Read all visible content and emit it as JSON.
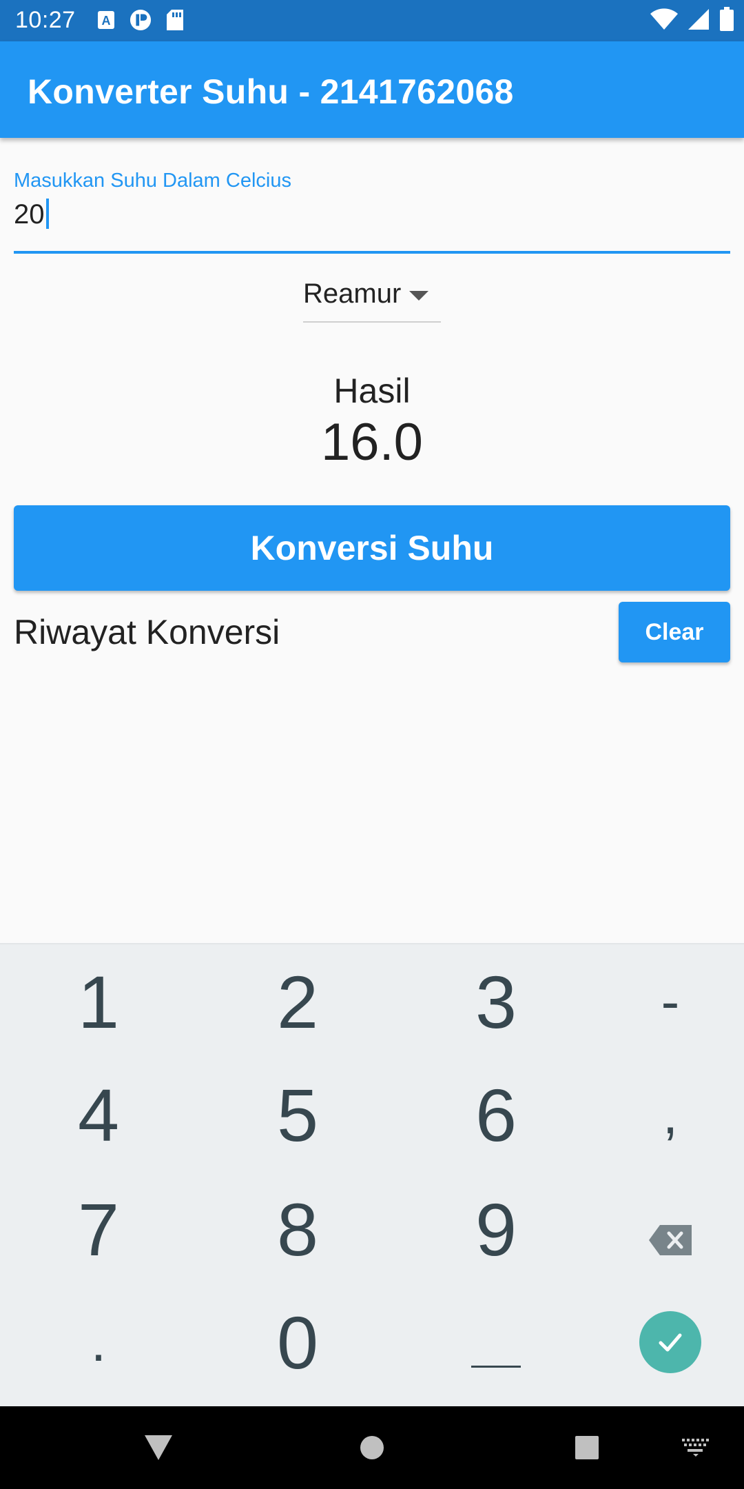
{
  "status_bar": {
    "time": "10:27",
    "left_icons": [
      "font-icon",
      "app-icon",
      "sd-card-icon"
    ],
    "right_icons": [
      "wifi-icon",
      "signal-icon",
      "battery-icon"
    ]
  },
  "app_bar": {
    "title": "Konverter Suhu - 2141762068"
  },
  "input": {
    "label": "Masukkan Suhu Dalam Celcius",
    "value": "20"
  },
  "dropdown": {
    "selected": "Reamur"
  },
  "result": {
    "label": "Hasil",
    "value": "16.0"
  },
  "convert_button": {
    "label": "Konversi Suhu"
  },
  "history": {
    "title": "Riwayat Konversi",
    "clear_label": "Clear"
  },
  "keyboard": {
    "rows": [
      [
        "1",
        "2",
        "3",
        "-"
      ],
      [
        "4",
        "5",
        "6",
        ","
      ],
      [
        "7",
        "8",
        "9",
        "backspace"
      ],
      [
        ".",
        "0",
        "space",
        "done"
      ]
    ]
  },
  "colors": {
    "primary": "#2196f3",
    "status_bar": "#1b72bf",
    "key_text": "#37474f",
    "confirm": "#4db6ac"
  }
}
